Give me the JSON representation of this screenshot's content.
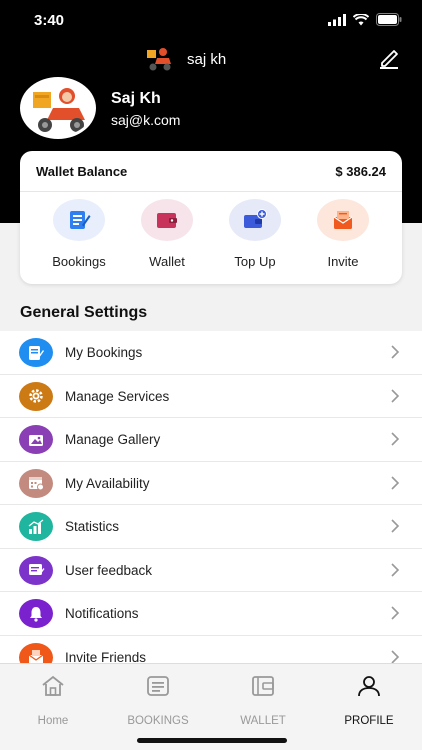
{
  "status_bar": {
    "time": "3:40"
  },
  "top_nav": {
    "username": "saj kh"
  },
  "profile": {
    "name": "Saj Kh",
    "email": "saj@k.com"
  },
  "wallet_card": {
    "title": "Wallet Balance",
    "amount": "$ 386.24",
    "actions": [
      {
        "label": "Bookings",
        "icon": "bookings-icon",
        "color": "#2f7ff0"
      },
      {
        "label": "Wallet",
        "icon": "wallet-icon",
        "color": "#c8335c"
      },
      {
        "label": "Top Up",
        "icon": "top-up-icon",
        "color": "#3b5bdb"
      },
      {
        "label": "Invite",
        "icon": "invite-icon",
        "color": "#f05a1e"
      }
    ]
  },
  "general_settings": {
    "title": "General Settings",
    "items": [
      {
        "label": "My Bookings",
        "icon": "bookings-icon",
        "color": "#1f8ef0"
      },
      {
        "label": "Manage Services",
        "icon": "gear-icon",
        "color": "#cc7a14"
      },
      {
        "label": "Manage Gallery",
        "icon": "gallery-icon",
        "color": "#8a3fb5"
      },
      {
        "label": "My Availability",
        "icon": "calendar-icon",
        "color": "#c38b7f"
      },
      {
        "label": "Statistics",
        "icon": "bar-chart-icon",
        "color": "#1fb59e"
      },
      {
        "label": "User feedback",
        "icon": "feedback-icon",
        "color": "#7b33c9"
      },
      {
        "label": "Notifications",
        "icon": "bell-icon",
        "color": "#7b22cf"
      },
      {
        "label": "Invite Friends",
        "icon": "invite-icon",
        "color": "#f0581a"
      }
    ]
  },
  "tabbar": {
    "tabs": [
      {
        "label": "Home",
        "icon": "home-icon",
        "active": false
      },
      {
        "label": "BOOKINGS",
        "icon": "bookings-icon",
        "active": false
      },
      {
        "label": "WALLET",
        "icon": "wallet-icon",
        "active": false
      },
      {
        "label": "PROFILE",
        "icon": "person-icon",
        "active": true
      }
    ]
  }
}
